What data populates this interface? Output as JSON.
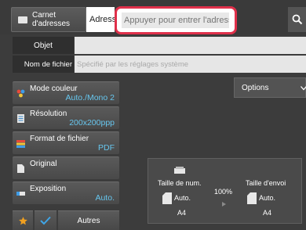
{
  "address_bar": {
    "address_book_label_1": "Carnet",
    "address_book_label_2": "d'adresses",
    "address_tab_label": "Adresse",
    "address_placeholder": "Appuyer pour entrer l'adresse"
  },
  "fields": {
    "subject_label": "Objet",
    "subject_value": "",
    "filename_label": "Nom de fichier",
    "filename_placeholder": "Spécifié par les réglages système"
  },
  "settings": [
    {
      "title": "Mode couleur",
      "value": "Auto./Mono 2"
    },
    {
      "title": "Résolution",
      "value": "200x200ppp"
    },
    {
      "title": "Format de fichier",
      "value": "PDF"
    },
    {
      "title": "Original",
      "value": ""
    },
    {
      "title": "Exposition",
      "value": "Auto."
    }
  ],
  "bottom": {
    "other_label": "Autres"
  },
  "options_label": "Options",
  "preview": {
    "scan_size_label": "Taille de num.",
    "scan_size_mode": "Auto.",
    "scan_size_paper": "A4",
    "zoom": "100%",
    "send_size_label": "Taille d'envoi",
    "send_size_mode": "Auto.",
    "send_size_paper": "A4"
  },
  "colors": {
    "accent_value": "#67c6ee",
    "highlight_border": "#e0304a",
    "favorite": "#f0a020",
    "check": "#3fa6e8"
  }
}
